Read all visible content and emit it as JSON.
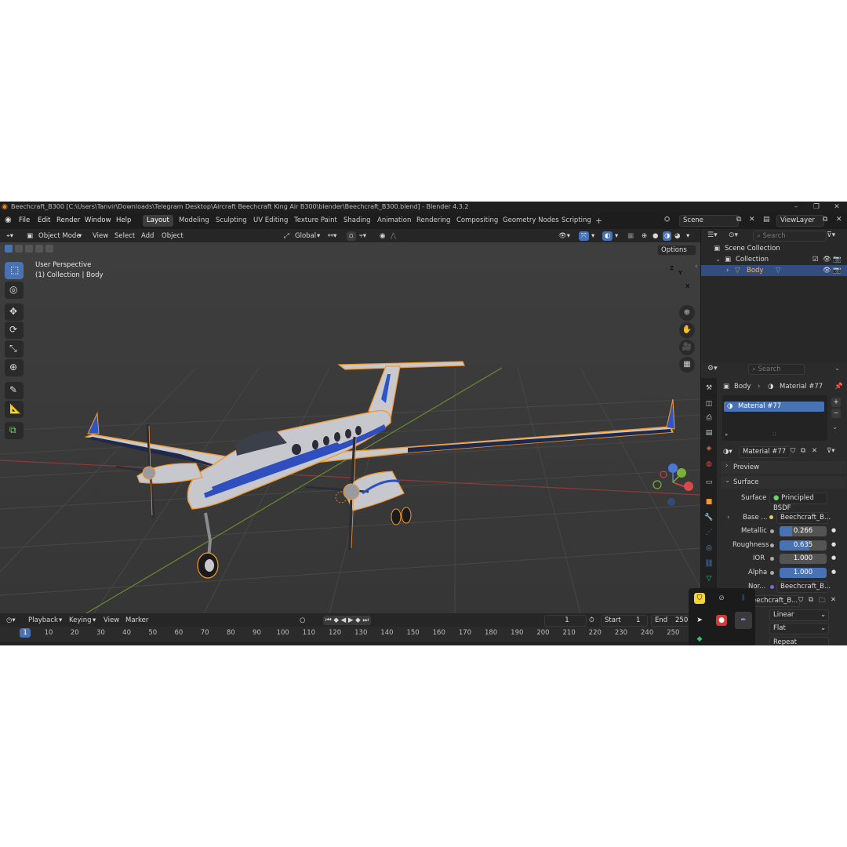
{
  "window": {
    "title": "Beechcraft_B300 [C:\\Users\\Tanvir\\Downloads\\Telegram Desktop\\Aircraft Beechcraft King Air B300\\blender\\Beechcraft_B300.blend] - Blender 4.3.2"
  },
  "menu": [
    "File",
    "Edit",
    "Render",
    "Window",
    "Help"
  ],
  "workspaces": [
    "Layout",
    "Modeling",
    "Sculpting",
    "UV Editing",
    "Texture Paint",
    "Shading",
    "Animation",
    "Rendering",
    "Compositing",
    "Geometry Nodes",
    "Scripting"
  ],
  "active_workspace": "Layout",
  "scene": "Scene",
  "view_layer": "ViewLayer",
  "viewport_header": {
    "mode": "Object Mode",
    "menus": [
      "View",
      "Select",
      "Add",
      "Object"
    ],
    "transform_orientation": "Global",
    "options": "Options"
  },
  "viewport": {
    "perspective": "User Perspective",
    "collection_info": "(1) Collection | Body",
    "gizmo_axes": [
      "Z",
      "Y",
      "X"
    ]
  },
  "outliner": {
    "search_placeholder": "Search",
    "items": [
      {
        "label": "Scene Collection"
      },
      {
        "label": "Collection"
      },
      {
        "label": "Body"
      }
    ]
  },
  "properties": {
    "search_placeholder": "Search",
    "breadcrumb_object": "Body",
    "breadcrumb_material": "Material #77",
    "slot_name": "Material #77",
    "material_name": "Material #77",
    "panels": {
      "preview": "Preview",
      "surface": "Surface"
    },
    "surface": {
      "label": "Surface",
      "value": "Principled BSDF"
    },
    "base_color": {
      "label": "Base ...",
      "value": "Beechcraft_B..."
    },
    "metallic": {
      "label": "Metallic",
      "value": "0.266",
      "fill": 0.266
    },
    "roughness": {
      "label": "Roughness",
      "value": "0.635",
      "fill": 0.635
    },
    "ior": {
      "label": "IOR",
      "value": "1.000"
    },
    "alpha": {
      "label": "Alpha",
      "value": "1.000",
      "fill": 1.0
    },
    "normal": {
      "label": "Nor...",
      "value": "Beechcraft_B..."
    },
    "image": {
      "value": "eechcraft_B..."
    },
    "interpolation": "Linear",
    "projection": "Flat",
    "extension": "Repeat"
  },
  "timeline": {
    "menus": [
      "Playback",
      "Keying",
      "View",
      "Marker"
    ],
    "current_frame": "1",
    "start_label": "Start",
    "start": "1",
    "end_label": "End",
    "end": "250",
    "ruler": [
      "1",
      "10",
      "20",
      "30",
      "40",
      "50",
      "60",
      "70",
      "80",
      "90",
      "100",
      "110",
      "120",
      "130",
      "140",
      "150",
      "160",
      "170",
      "180",
      "190",
      "200",
      "210",
      "220",
      "230",
      "240",
      "250"
    ]
  },
  "colors": {
    "accent": "#4772b3",
    "selection_outline": "#f5a03a",
    "background": "#303030",
    "viewport": "#3d3d3d"
  }
}
